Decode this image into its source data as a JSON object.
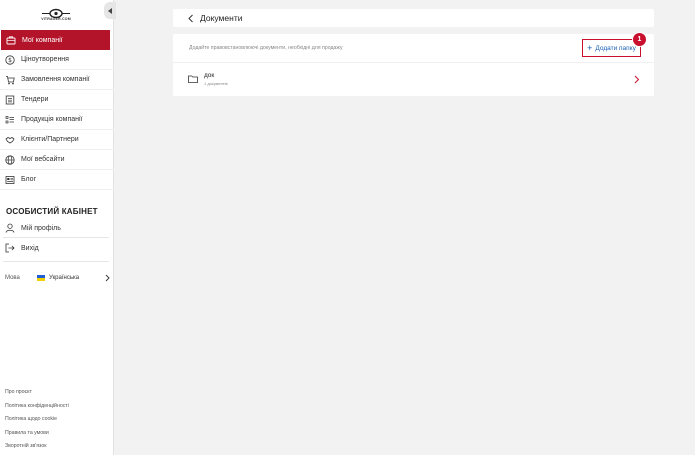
{
  "brand": {
    "logo_text": "VITRAGER.COM"
  },
  "sidebar": {
    "menu": [
      {
        "label": "Мої компанії",
        "icon": "briefcase-icon",
        "active": true
      },
      {
        "label": "Ціноутворення",
        "icon": "dollar-icon",
        "active": false
      },
      {
        "label": "Замовлення компанії",
        "icon": "cart-icon",
        "active": false
      },
      {
        "label": "Тендери",
        "icon": "document-list-icon",
        "active": false
      },
      {
        "label": "Продукція компанії",
        "icon": "checklist-icon",
        "active": false
      },
      {
        "label": "Клієнти/Партнери",
        "icon": "handshake-icon",
        "active": false
      },
      {
        "label": "Мої вебсайти",
        "icon": "globe-icon",
        "active": false
      },
      {
        "label": "Блог",
        "icon": "newspaper-icon",
        "active": false
      }
    ],
    "cabinet_title": "ОСОБИСТИЙ КАБІНЕТ",
    "profile_label": "Мій профіль",
    "logout_label": "Вихід",
    "language_label": "Мова",
    "language_value": "Українська",
    "footer_links": [
      "Про проєкт",
      "Політика конфіденційності",
      "Політика щодо cookie",
      "Правила та умови",
      "Зворотній зв'язок"
    ]
  },
  "header": {
    "title": "Документи"
  },
  "documents": {
    "hint": "Додайте правовстановлюючі документи, необхідні для продажу",
    "add_folder_label": "Додати папку",
    "badge": "1",
    "folders": [
      {
        "name": "док",
        "count": "1 документів"
      }
    ]
  },
  "colors": {
    "accent": "#b4142a",
    "link": "#1a5fb4"
  }
}
